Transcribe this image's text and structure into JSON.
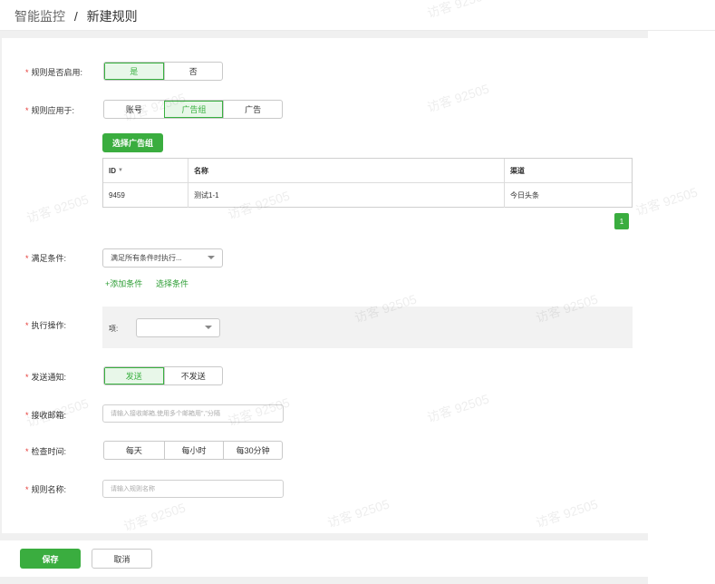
{
  "breadcrumb": {
    "root": "智能监控",
    "separator": "/",
    "current": "新建规则"
  },
  "form": {
    "required_mark": "*",
    "enable": {
      "label": "规则是否启用:",
      "options": [
        "是",
        "否"
      ],
      "selected": "是"
    },
    "apply_to": {
      "label": "规则应用于:",
      "options": [
        "账号",
        "广告组",
        "广告"
      ],
      "selected": "广告组"
    },
    "select_adgroup_button": "选择广告组",
    "table": {
      "headers": {
        "id": "ID",
        "name": "名称",
        "channel": "渠道"
      },
      "rows": [
        {
          "id": "9459",
          "name": "测试1-1",
          "channel": "今日头条"
        }
      ]
    },
    "pagination": {
      "current_page": "1"
    },
    "condition": {
      "label": "满足条件:",
      "select_value": "满足所有条件时执行...",
      "add_condition_link": "+添加条件",
      "choose_condition_link": "选择条件"
    },
    "action": {
      "label": "执行操作:",
      "item_label": "项:"
    },
    "notify": {
      "label": "发送通知:",
      "options": [
        "发送",
        "不发送"
      ],
      "selected": "发送"
    },
    "email": {
      "label": "接收邮箱:",
      "placeholder": "请输入接收邮箱,使用多个邮箱用\",\"分隔"
    },
    "check_time": {
      "label": "检查时间:",
      "options": [
        "每天",
        "每小时",
        "每30分钟"
      ]
    },
    "rule_name": {
      "label": "规则名称:",
      "placeholder": "请输入规则名称"
    }
  },
  "footer": {
    "save": "保存",
    "cancel": "取消"
  },
  "watermark": "访客 92505",
  "colors": {
    "primary_green": "#3aad3f",
    "active_bg": "#e8f7e9",
    "required_red": "#e53935"
  }
}
